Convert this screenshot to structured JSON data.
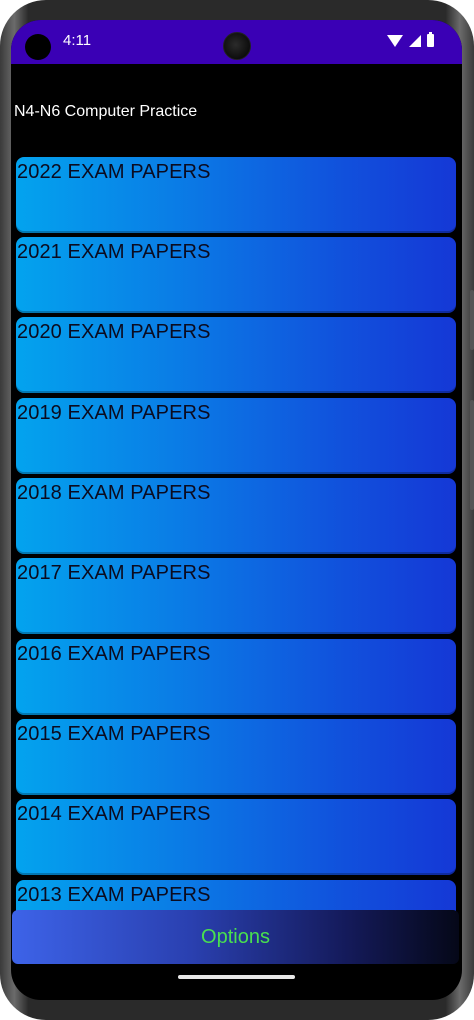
{
  "status_bar": {
    "time": "4:11",
    "icons": [
      "wifi-icon",
      "signal-icon",
      "battery-icon"
    ],
    "background": "#3a00b5"
  },
  "app": {
    "title": "N4-N6 Computer Practice"
  },
  "papers": [
    {
      "label": "2022 EXAM PAPERS"
    },
    {
      "label": "2021 EXAM PAPERS"
    },
    {
      "label": "2020 EXAM PAPERS"
    },
    {
      "label": "2019 EXAM PAPERS"
    },
    {
      "label": "2018 EXAM PAPERS"
    },
    {
      "label": "2017 EXAM PAPERS"
    },
    {
      "label": "2016 EXAM PAPERS"
    },
    {
      "label": "2015 EXAM PAPERS"
    },
    {
      "label": "2014 EXAM PAPERS"
    },
    {
      "label": "2013 EXAM PAPERS"
    }
  ],
  "options_button": {
    "label": "Options",
    "label_color": "#49e04f"
  },
  "colors": {
    "card_gradient_start": "#03a3ee",
    "card_gradient_end": "#1538d6",
    "screen_background": "#000000"
  }
}
